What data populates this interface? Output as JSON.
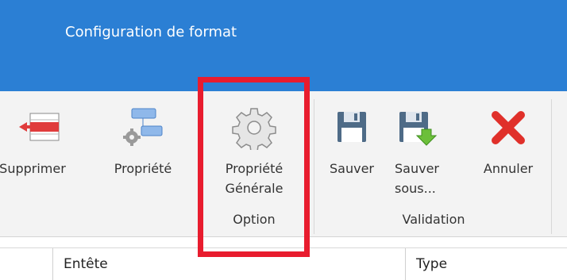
{
  "window": {
    "title": "Configuration de format"
  },
  "ribbon": {
    "buttons": [
      {
        "label": "Supprimer",
        "icon": "delete-row-icon"
      },
      {
        "label": "Propriété",
        "icon": "property-icon"
      },
      {
        "label": "Propriété\nGénérale",
        "icon": "gear-icon"
      },
      {
        "label": "Sauver",
        "icon": "save-icon"
      },
      {
        "label": "Sauver\nsous...",
        "icon": "save-as-icon"
      },
      {
        "label": "Annuler",
        "icon": "cancel-icon"
      }
    ],
    "groups": {
      "option": "Option",
      "validation": "Validation"
    }
  },
  "grid": {
    "columns": [
      "Entête",
      "Type"
    ]
  },
  "colors": {
    "title_bar": "#2b7fd4",
    "highlight": "#e81c2e",
    "cancel": "#e0302a"
  }
}
